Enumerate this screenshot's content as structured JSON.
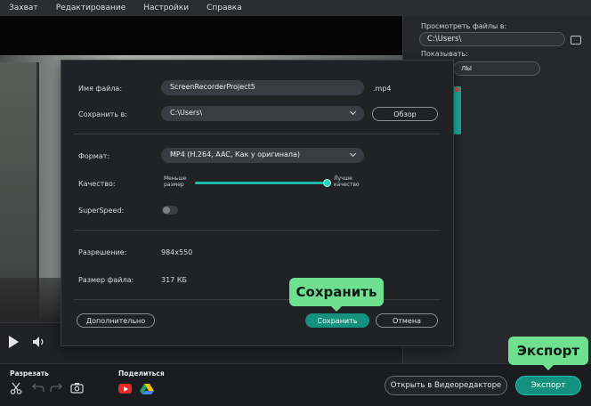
{
  "menu": {
    "items": [
      {
        "label": "Захват"
      },
      {
        "label": "Редактирование"
      },
      {
        "label": "Настройки"
      },
      {
        "label": "Справка"
      }
    ]
  },
  "right_panel": {
    "browse_label": "Просмотреть файлы в:",
    "browse_path": "C:\\Users\\",
    "show_label": "Показывать:",
    "show_value": "лы"
  },
  "dialog": {
    "filename_label": "Имя файла:",
    "filename_value": "ScreenRecorderProject5",
    "extension": ".mp4",
    "save_in_label": "Сохранить в:",
    "save_in_value": "C:\\Users\\",
    "browse_button": "Обзор",
    "format_label": "Формат:",
    "format_value": "MP4 (H.264, AAC, Как у оригинала)",
    "quality_label": "Качество:",
    "quality_min_label": "Меньше размер",
    "quality_max_label": "Лучше качество",
    "quality_level": 1.0,
    "superspeed_label": "SuperSpeed:",
    "superspeed_on": false,
    "resolution_label": "Разрешение:",
    "resolution_value": "984x550",
    "filesize_label": "Размер файла:",
    "filesize_value": "317 КБ",
    "advanced_button": "Дополнительно",
    "save_button": "Сохранить",
    "cancel_button": "Отмена"
  },
  "bottom_bar": {
    "cut_label": "Разрезать",
    "share_label": "Поделиться",
    "open_editor_button": "Открыть в Видеоредакторе",
    "export_button": "Экспорт"
  },
  "callouts": {
    "save": "Сохранить",
    "export": "Экспорт"
  },
  "colors": {
    "accent": "#14917f",
    "callout": "#6ee08f"
  }
}
